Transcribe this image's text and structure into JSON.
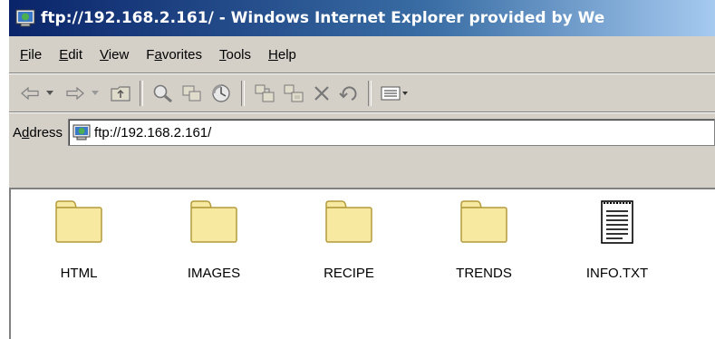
{
  "window": {
    "title": "ftp://192.168.2.161/ - Windows Internet Explorer provided by We",
    "icon": "ie-ftp-page-icon"
  },
  "menubar": {
    "items": [
      {
        "label": "File",
        "mnemonic": "F"
      },
      {
        "label": "Edit",
        "mnemonic": "E"
      },
      {
        "label": "View",
        "mnemonic": "V"
      },
      {
        "label": "Favorites",
        "mnemonic": "a"
      },
      {
        "label": "Tools",
        "mnemonic": "T"
      },
      {
        "label": "Help",
        "mnemonic": "H"
      }
    ]
  },
  "toolbar": {
    "buttons": [
      "back-icon",
      "back-dropdown-icon",
      "forward-icon",
      "forward-dropdown-icon",
      "up-folder-icon",
      "search-icon",
      "folders-icon",
      "history-icon",
      "move-to-icon",
      "copy-to-icon",
      "delete-icon",
      "undo-icon",
      "views-icon"
    ]
  },
  "address": {
    "label": "Address",
    "value": "ftp://192.168.2.161/"
  },
  "files": [
    {
      "name": "HTML",
      "type": "folder"
    },
    {
      "name": "IMAGES",
      "type": "folder"
    },
    {
      "name": "RECIPE",
      "type": "folder"
    },
    {
      "name": "TRENDS",
      "type": "folder"
    },
    {
      "name": "INFO.TXT",
      "type": "text-file"
    }
  ],
  "colors": {
    "title_start": "#0a246a",
    "title_end": "#a6caf0",
    "chrome": "#d4d0c8",
    "folder_fill": "#f7e9a0",
    "folder_stroke": "#b49b3c"
  }
}
